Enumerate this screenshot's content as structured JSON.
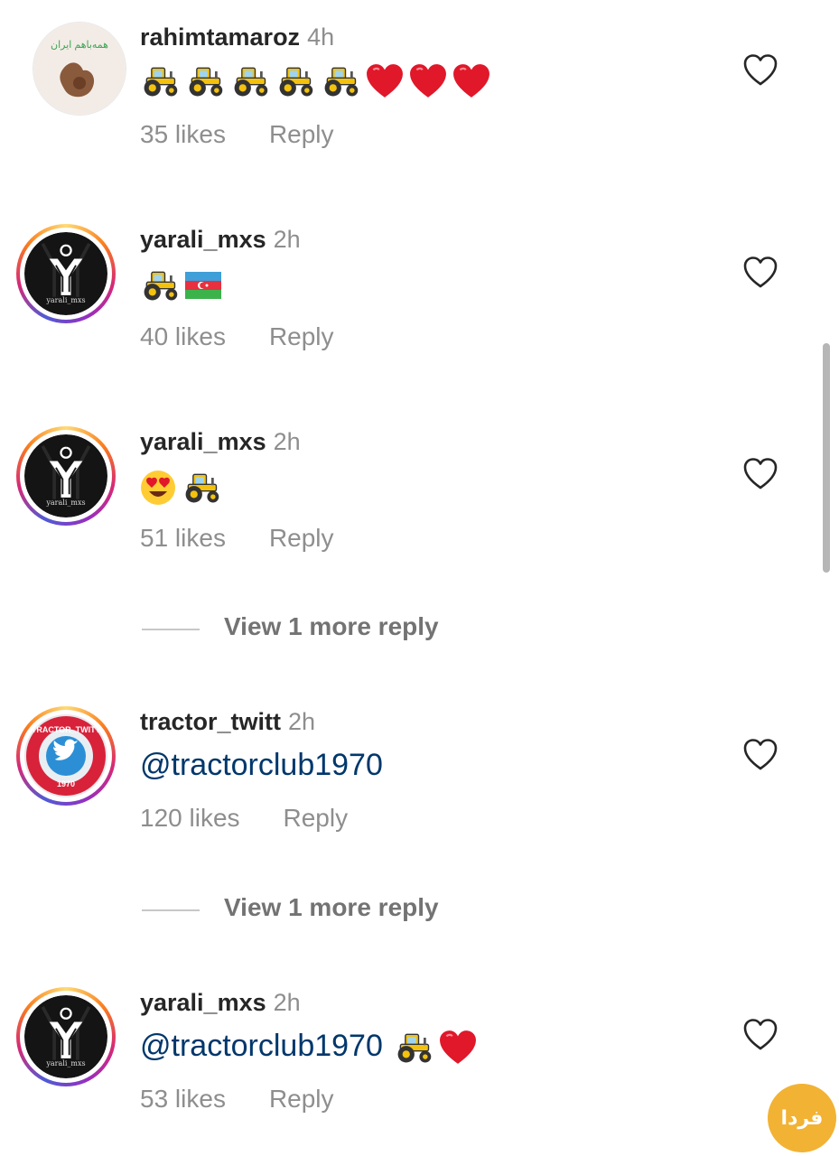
{
  "comments": [
    {
      "username": "rahimtamaroz",
      "time": "4h",
      "avatar_text": "همه‌باهم ایران",
      "emojis": [
        "tractor-emoji",
        "tractor-emoji",
        "tractor-emoji",
        "tractor-emoji",
        "tractor-emoji",
        "red-heart-emoji",
        "red-heart-emoji",
        "red-heart-emoji"
      ],
      "likes": "35 likes",
      "reply": "Reply"
    },
    {
      "username": "yarali_mxs",
      "time": "2h",
      "avatar_text": "yarali_mxs",
      "emojis": [
        "tractor-emoji",
        "azerbaijan-flag-emoji"
      ],
      "likes": "40 likes",
      "reply": "Reply"
    },
    {
      "username": "yarali_mxs",
      "time": "2h",
      "avatar_text": "yarali_mxs",
      "emojis": [
        "heart-eyes-emoji",
        "tractor-emoji"
      ],
      "likes": "51 likes",
      "reply": "Reply",
      "view_replies": "View 1 more reply"
    },
    {
      "username": "tractor_twitt",
      "time": "2h",
      "avatar_text": "TRACTOR_TWITT",
      "avatar_year": "1970",
      "mention": "@tractorclub1970",
      "likes": "120 likes",
      "reply": "Reply",
      "view_replies": "View 1 more reply"
    },
    {
      "username": "yarali_mxs",
      "time": "2h",
      "avatar_text": "yarali_mxs",
      "mention": "@tractorclub1970",
      "emojis": [
        "tractor-emoji",
        "red-heart-emoji"
      ],
      "likes": "53 likes",
      "reply": "Reply"
    }
  ],
  "colors": {
    "text": "#262626",
    "secondary": "#8e8e8e",
    "mention": "#00376b",
    "story_ring": [
      "#feda75",
      "#fa7e1e",
      "#d62976",
      "#962fbf"
    ],
    "watermark": "#f2b233"
  },
  "watermark_text": "فردا"
}
